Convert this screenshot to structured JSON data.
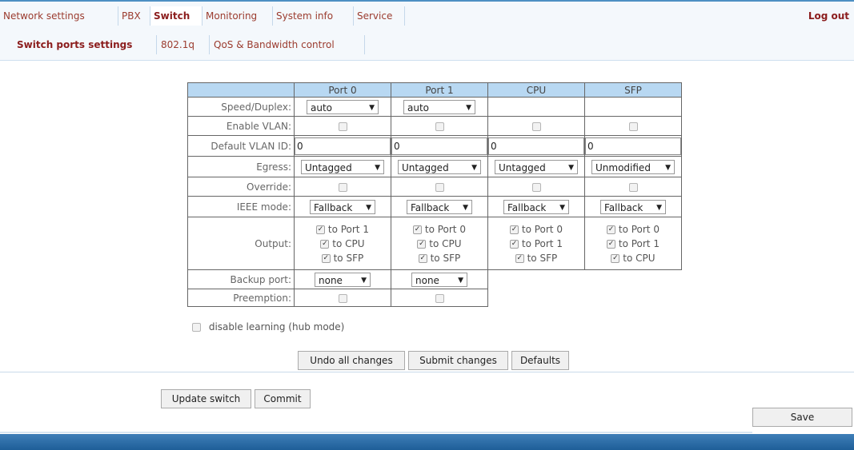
{
  "nav": {
    "items": [
      {
        "label": "Network settings"
      },
      {
        "label": "PBX"
      },
      {
        "label": "Switch"
      },
      {
        "label": "Monitoring"
      },
      {
        "label": "System info"
      },
      {
        "label": "Service"
      }
    ],
    "logout": "Log out"
  },
  "subnav": {
    "items": [
      {
        "label": "Switch ports settings"
      },
      {
        "label": "802.1q"
      },
      {
        "label": "QoS & Bandwidth control"
      }
    ]
  },
  "table": {
    "columns": [
      "Port 0",
      "Port 1",
      "CPU",
      "SFP"
    ],
    "rows": {
      "speed_duplex": "Speed/Duplex:",
      "enable_vlan": "Enable VLAN:",
      "default_vlan_id": "Default VLAN ID:",
      "egress": "Egress:",
      "override": "Override:",
      "ieee_mode": "IEEE mode:",
      "output": "Output:",
      "backup_port": "Backup port:",
      "preemption": "Preemption:"
    },
    "speed": [
      "auto",
      "auto"
    ],
    "vlan_ids": [
      "0",
      "0",
      "0",
      "0"
    ],
    "egress": [
      "Untagged",
      "Untagged",
      "Untagged",
      "Unmodified"
    ],
    "ieee": [
      "Fallback",
      "Fallback",
      "Fallback",
      "Fallback"
    ],
    "output": [
      [
        "to Port 1",
        "to CPU",
        "to SFP"
      ],
      [
        "to Port 0",
        "to CPU",
        "to SFP"
      ],
      [
        "to Port 0",
        "to Port 1",
        "to SFP"
      ],
      [
        "to Port 0",
        "to Port 1",
        "to CPU"
      ]
    ],
    "backup": [
      "none",
      "none"
    ]
  },
  "learning_label": "disable learning (hub mode)",
  "buttons": {
    "undo": "Undo all changes",
    "submit": "Submit changes",
    "defaults": "Defaults",
    "update_switch": "Update switch",
    "commit": "Commit",
    "save": "Save"
  }
}
